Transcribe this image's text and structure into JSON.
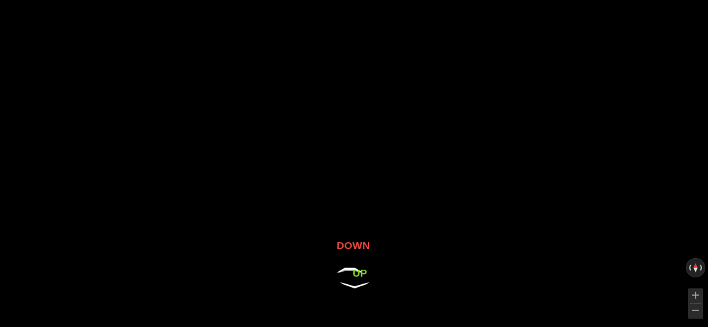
{
  "viewer": {
    "background": "#000000"
  },
  "navigation": {
    "down_label": "DOWN",
    "up_label": "UP",
    "down_color": "#e8463c",
    "up_color": "#7ed321",
    "arrow_up_icon": "chevron-up-icon",
    "arrow_down_icon": "chevron-down-icon"
  },
  "controls": {
    "compass_icon": "compass-icon",
    "zoom_in_label": "+",
    "zoom_out_label": "−"
  }
}
